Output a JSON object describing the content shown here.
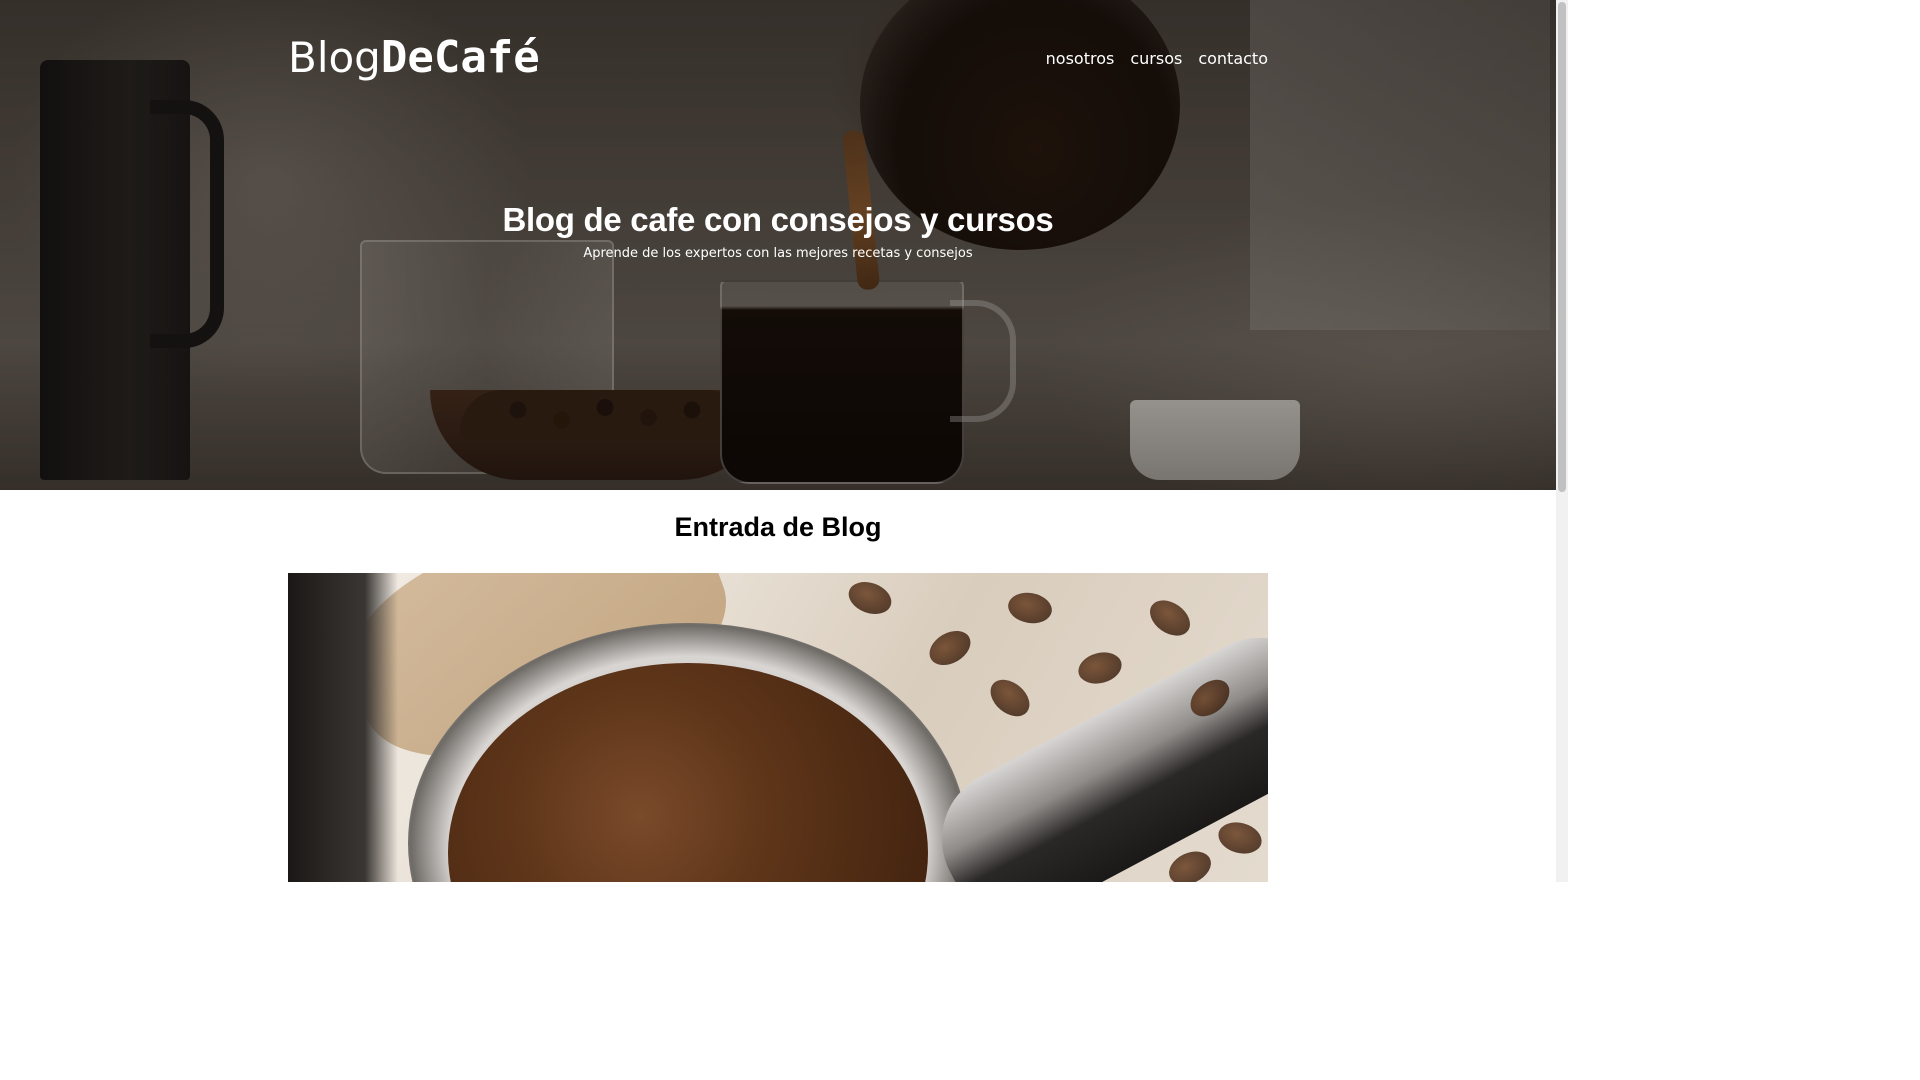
{
  "site": {
    "logo_light": "Blog",
    "logo_bold": "DeCafé"
  },
  "nav": {
    "items": [
      {
        "label": "nosotros"
      },
      {
        "label": "cursos"
      },
      {
        "label": "contacto"
      }
    ]
  },
  "hero": {
    "title": "Blog de cafe con consejos y cursos",
    "subtitle": "Aprende de los expertos con las mejores recetas y consejos"
  },
  "main": {
    "section_title": "Entrada de Blog"
  },
  "colors": {
    "text_on_hero": "#ffffff",
    "heading": "#000000",
    "background": "#ffffff"
  }
}
